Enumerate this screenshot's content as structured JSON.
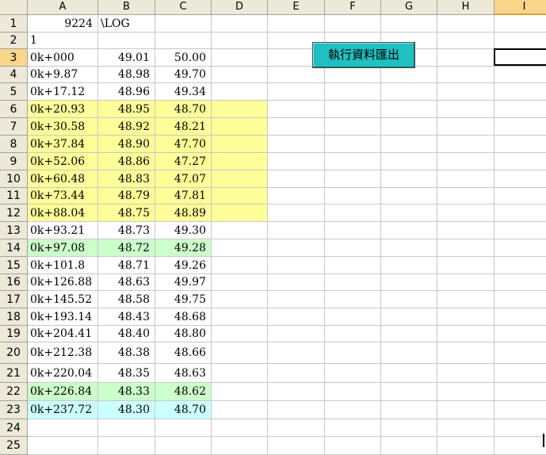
{
  "columns": [
    "A",
    "B",
    "C",
    "D",
    "E",
    "F",
    "G",
    "H",
    "I"
  ],
  "active_column": "I",
  "active_row": 3,
  "row_numbers": [
    1,
    2,
    3,
    4,
    5,
    6,
    7,
    8,
    9,
    10,
    11,
    12,
    13,
    14,
    15,
    16,
    17,
    18,
    19,
    20,
    21,
    22,
    23,
    24,
    25
  ],
  "header_cells": {
    "a1": "9224",
    "b1": "\\LOG",
    "a2": "1"
  },
  "data_rows": [
    {
      "row": 3,
      "station": "0k+000",
      "b": "49.01",
      "c": "50.00",
      "fill": "none"
    },
    {
      "row": 4,
      "station": "0k+9.87",
      "b": "48.98",
      "c": "49.70",
      "fill": "none"
    },
    {
      "row": 5,
      "station": "0k+17.12",
      "b": "48.96",
      "c": "49.34",
      "fill": "none"
    },
    {
      "row": 6,
      "station": "0k+20.93",
      "b": "48.95",
      "c": "48.70",
      "fill": "yellow"
    },
    {
      "row": 7,
      "station": "0k+30.58",
      "b": "48.92",
      "c": "48.21",
      "fill": "yellow"
    },
    {
      "row": 8,
      "station": "0k+37.84",
      "b": "48.90",
      "c": "47.70",
      "fill": "yellow"
    },
    {
      "row": 9,
      "station": "0k+52.06",
      "b": "48.86",
      "c": "47.27",
      "fill": "yellow"
    },
    {
      "row": 10,
      "station": "0k+60.48",
      "b": "48.83",
      "c": "47.07",
      "fill": "yellow"
    },
    {
      "row": 11,
      "station": "0k+73.44",
      "b": "48.79",
      "c": "47.81",
      "fill": "yellow"
    },
    {
      "row": 12,
      "station": "0k+88.04",
      "b": "48.75",
      "c": "48.89",
      "fill": "yellow"
    },
    {
      "row": 13,
      "station": "0k+93.21",
      "b": "48.73",
      "c": "49.30",
      "fill": "none"
    },
    {
      "row": 14,
      "station": "0k+97.08",
      "b": "48.72",
      "c": "49.28",
      "fill": "green"
    },
    {
      "row": 15,
      "station": "0k+101.8",
      "b": "48.71",
      "c": "49.26",
      "fill": "none"
    },
    {
      "row": 16,
      "station": "0k+126.88",
      "b": "48.63",
      "c": "49.97",
      "fill": "none"
    },
    {
      "row": 17,
      "station": "0k+145.52",
      "b": "48.58",
      "c": "49.75",
      "fill": "none"
    },
    {
      "row": 18,
      "station": "0k+193.14",
      "b": "48.43",
      "c": "48.68",
      "fill": "none"
    },
    {
      "row": 19,
      "station": "0k+204.41",
      "b": "48.40",
      "c": "48.80",
      "fill": "none"
    },
    {
      "row": 20,
      "station": "0k+212.38",
      "b": "48.38",
      "c": "48.66",
      "fill": "none"
    },
    {
      "row": 21,
      "station": "0k+220.04",
      "b": "48.35",
      "c": "48.63",
      "fill": "none"
    },
    {
      "row": 22,
      "station": "0k+226.84",
      "b": "48.33",
      "c": "48.62",
      "fill": "green"
    },
    {
      "row": 23,
      "station": "0k+237.72",
      "b": "48.30",
      "c": "48.70",
      "fill": "cyan"
    }
  ],
  "fill_colors": {
    "yellow": "#ffff99",
    "green": "#ccffcc",
    "cyan": "#ccffff",
    "none": "#ffffff"
  },
  "macro_button": {
    "label": "執行資料匯出",
    "color": "#20c0c0"
  }
}
